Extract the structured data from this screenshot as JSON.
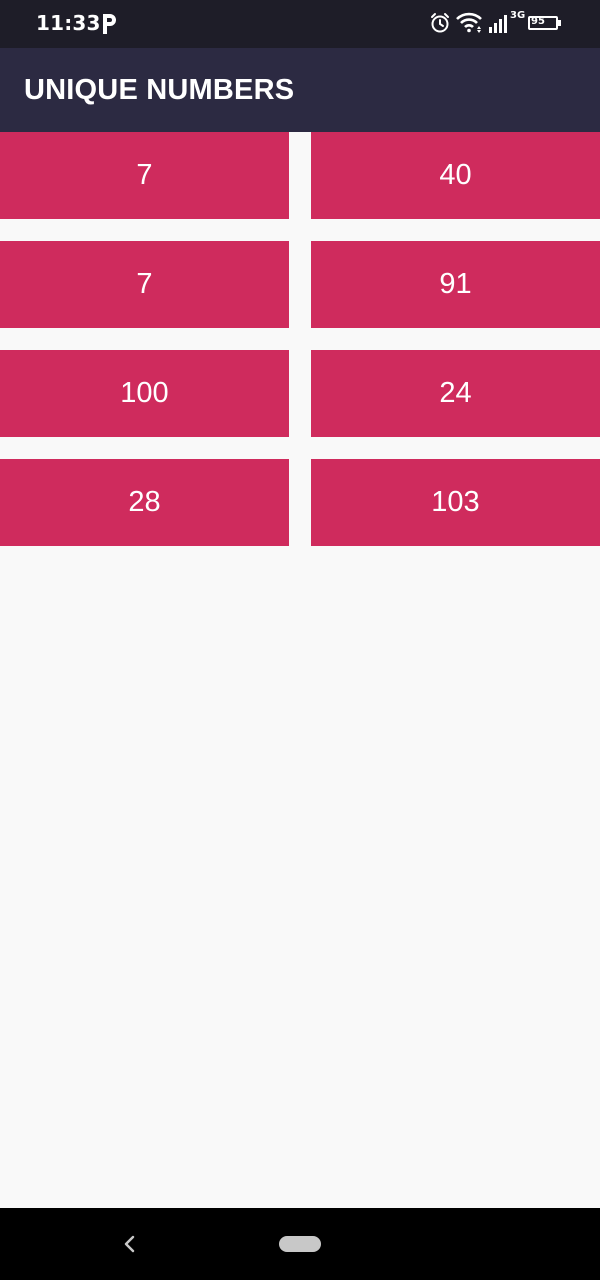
{
  "status_bar": {
    "time": "11:33",
    "network_type": "3G",
    "battery": "95",
    "icons": [
      "p-app-icon",
      "alarm-icon",
      "wifi-icon",
      "signal-icon",
      "battery-icon"
    ]
  },
  "app_bar": {
    "title": "UNIQUE NUMBERS"
  },
  "grid": {
    "cells": [
      "7",
      "40",
      "7",
      "91",
      "100",
      "24",
      "28",
      "103"
    ]
  },
  "nav_bar": {
    "icons": [
      "back-icon",
      "home-pill-icon"
    ]
  },
  "colors": {
    "status_bar": "#1e1d28",
    "app_bar": "#2c2a42",
    "cell": "#cf2b5d",
    "background": "#f9f9f9",
    "nav_bar": "#000000"
  }
}
